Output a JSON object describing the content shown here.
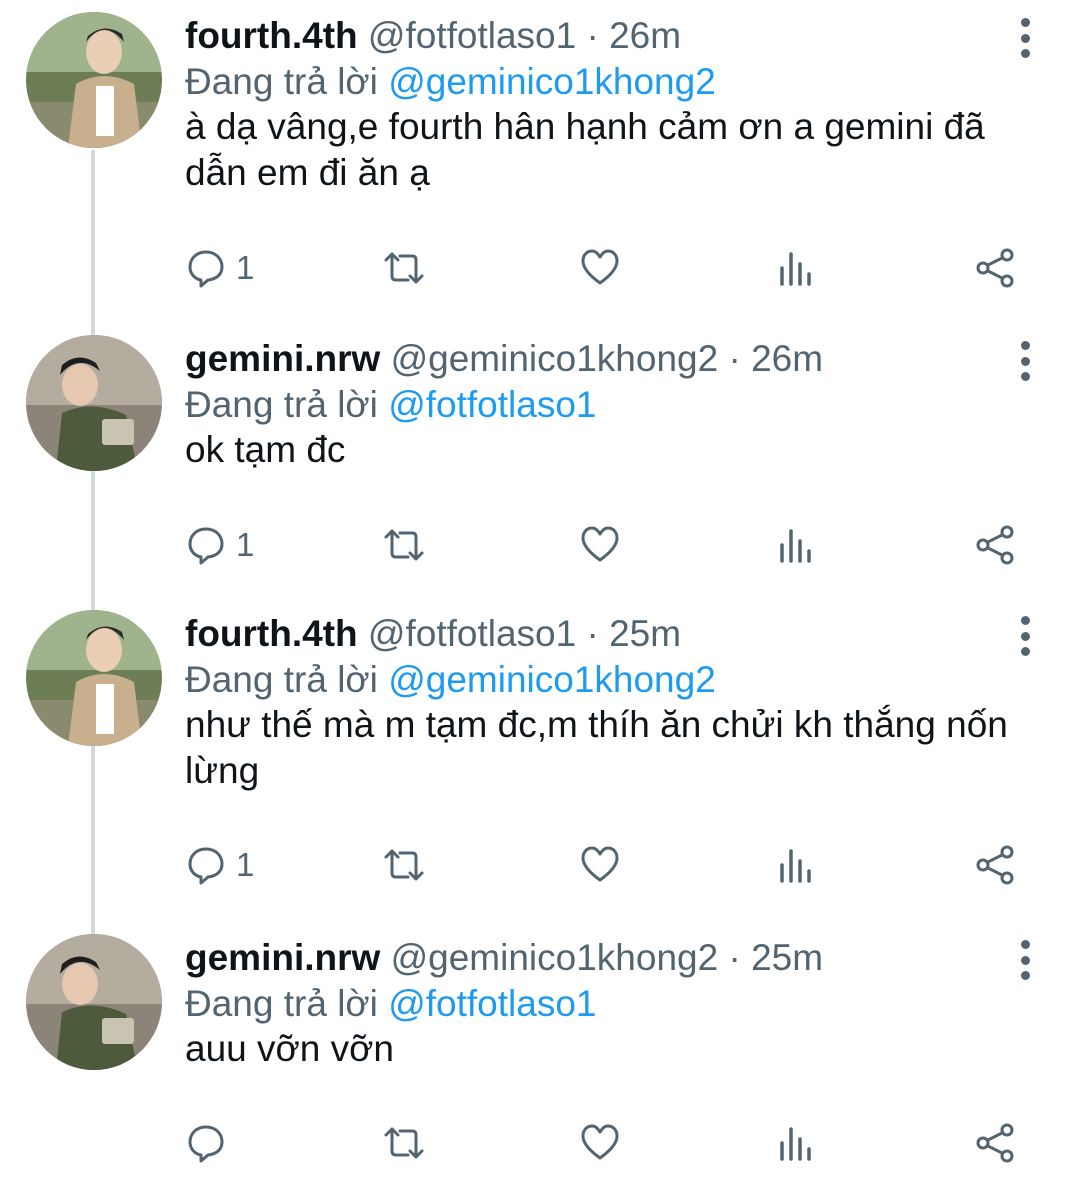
{
  "tweets": [
    {
      "name": "fourth.4th",
      "handle_time": "@fotfotlaso1 · 26m",
      "replying_prefix": "Đang trả lời",
      "replying_to": "@geminico1khong2",
      "text": "à dạ vâng,e fourth hân hạnh cảm ơn a gemini đã dẫn em đi ăn ạ",
      "reply_count": "1",
      "avatar": "fourth-avatar"
    },
    {
      "name": "gemini.nrw",
      "handle_time": "@geminico1khong2 · 26m",
      "replying_prefix": "Đang trả lời",
      "replying_to": "@fotfotlaso1",
      "text": "ok tạm đc",
      "reply_count": "1",
      "avatar": "gemini-avatar"
    },
    {
      "name": "fourth.4th",
      "handle_time": "@fotfotlaso1 · 25m",
      "replying_prefix": "Đang trả lời",
      "replying_to": "@geminico1khong2",
      "text": "như thế mà m tạm đc,m thíh ăn chửi kh thắng nốn lừng",
      "reply_count": "1",
      "avatar": "fourth-avatar"
    },
    {
      "name": "gemini.nrw",
      "handle_time": "@geminico1khong2 · 25m",
      "replying_prefix": "Đang trả lời",
      "replying_to": "@fotfotlaso1",
      "text": "auu vỡn vỡn",
      "reply_count": "",
      "avatar": "gemini-avatar"
    }
  ],
  "icons": {
    "reply": "reply-icon",
    "retweet": "retweet-icon",
    "like": "like-icon",
    "views": "views-icon",
    "share": "share-icon",
    "more": "more-vertical-icon"
  },
  "colors": {
    "text": "#0f1419",
    "secondary": "#536471",
    "mention": "#1d9bf0",
    "thread_line": "#cfd9de"
  }
}
